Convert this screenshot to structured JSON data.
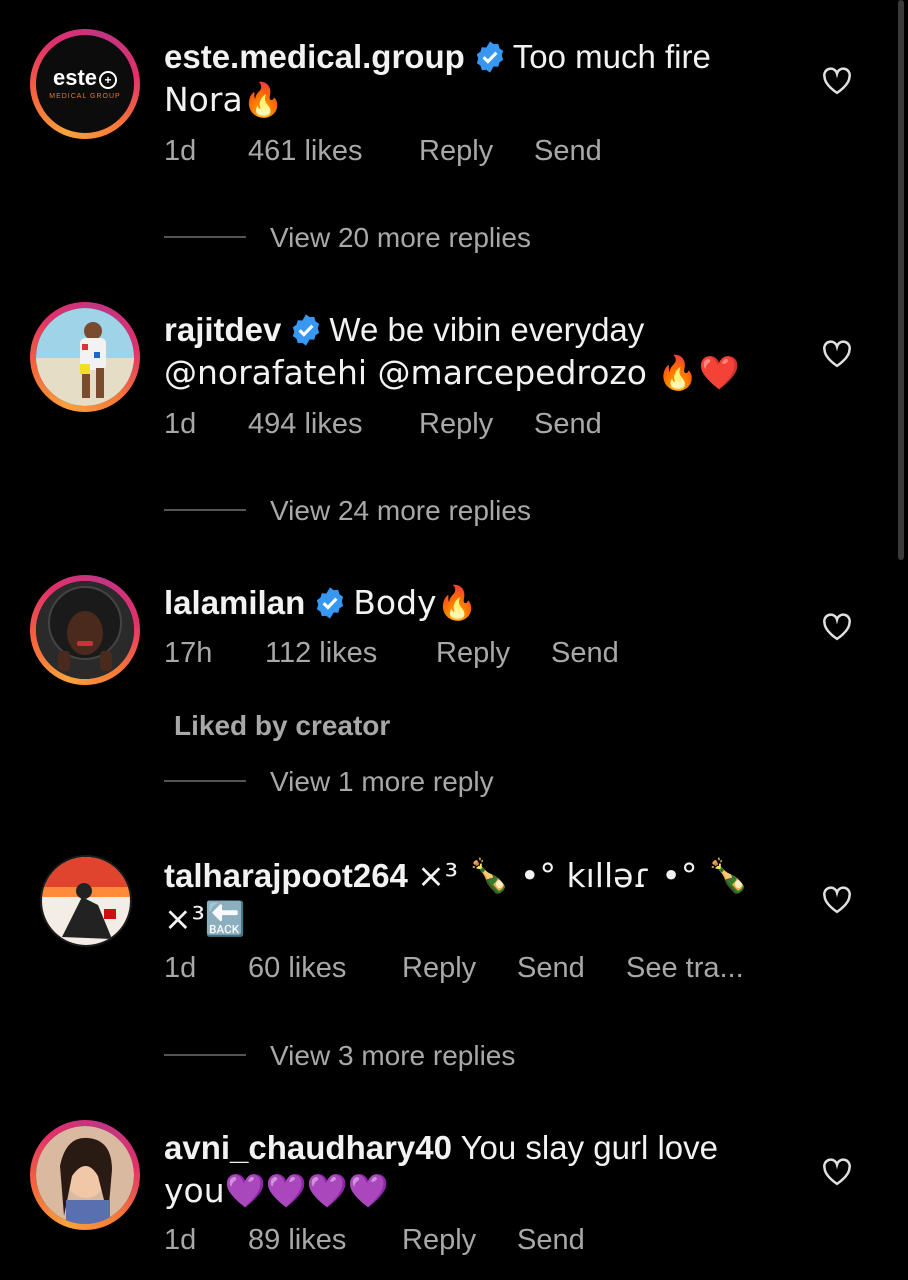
{
  "comments": [
    {
      "username": "este.medical.group",
      "verified": true,
      "text_line1": "Too much fire",
      "text_line2": "Nora🔥",
      "time": "1d",
      "likes": "461 likes",
      "reply": "Reply",
      "send": "Send",
      "view_replies": "View 20 more replies",
      "avatar_logo_main": "este",
      "avatar_logo_sub": "MEDICAL GROUP"
    },
    {
      "username": "rajitdev",
      "verified": true,
      "text_line1": "We be vibin everyday",
      "text_line2": "@norafatehi @marcepedrozo 🔥❤️",
      "time": "1d",
      "likes": "494 likes",
      "reply": "Reply",
      "send": "Send",
      "view_replies": "View 24 more replies"
    },
    {
      "username": "lalamilan",
      "verified": true,
      "text_line1": "Body🔥",
      "time": "17h",
      "likes": "112 likes",
      "reply": "Reply",
      "send": "Send",
      "liked_by": "Liked by creator",
      "view_replies": "View 1 more reply"
    },
    {
      "username": "talharajpoot264",
      "verified": false,
      "text_line1": "×³ 🍾 •° kılləɾ •° 🍾",
      "text_line2": "×³🔙",
      "time": "1d",
      "likes": "60 likes",
      "reply": "Reply",
      "send": "Send",
      "see_translation": "See tra...",
      "view_replies": "View 3 more replies"
    },
    {
      "username": "avni_chaudhary40",
      "verified": false,
      "text_line1": "You slay gurl love",
      "text_line2": "you💜💜💜💜",
      "time": "1d",
      "likes": "89 likes",
      "reply": "Reply",
      "send": "Send"
    }
  ],
  "icons": {
    "heart": "heart-outline-icon",
    "verified": "verified-badge-icon"
  },
  "colors": {
    "background": "#000000",
    "verified_blue": "#3897f0",
    "secondary_text": "#a8a8a8"
  }
}
